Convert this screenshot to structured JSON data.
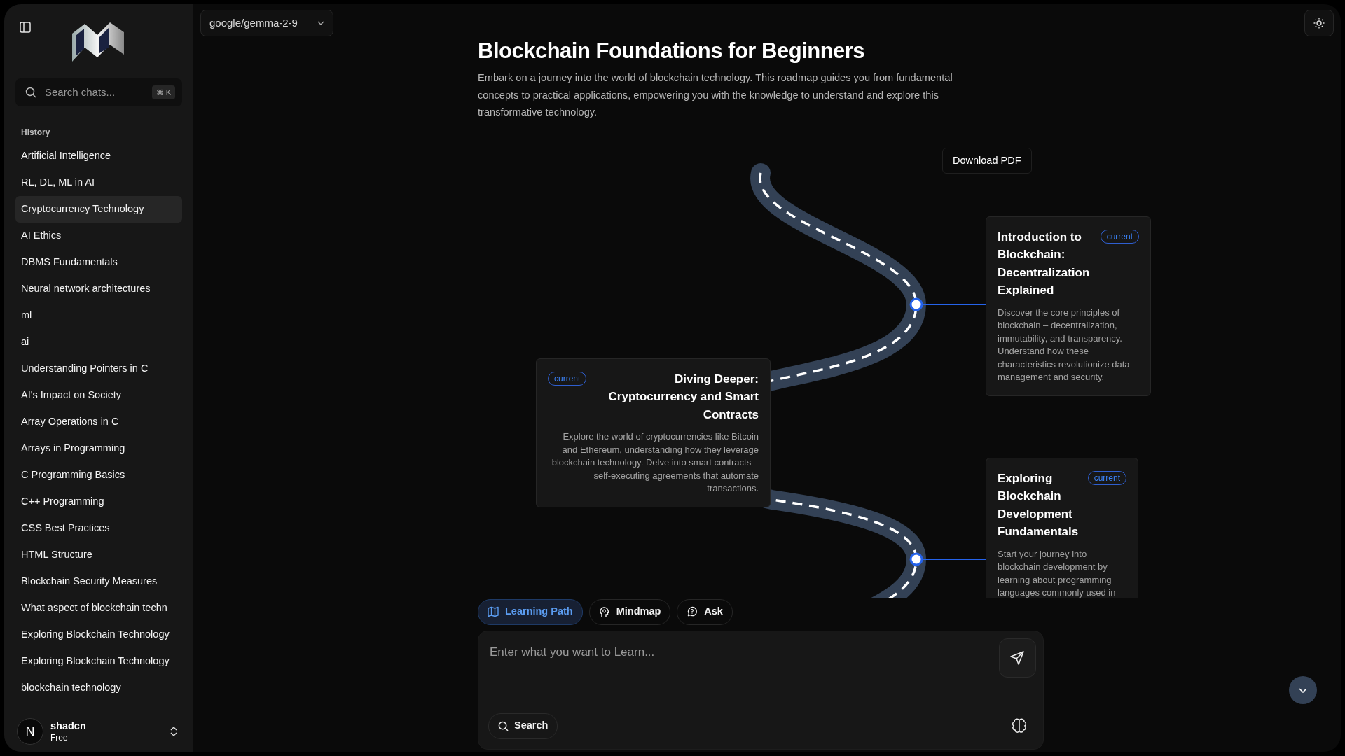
{
  "sidebar": {
    "search": {
      "placeholder": "Search chats...",
      "shortcut": "⌘ K"
    },
    "history_label": "History",
    "history": [
      {
        "title": "Artificial Intelligence",
        "selected": false
      },
      {
        "title": "RL, DL, ML in AI",
        "selected": false
      },
      {
        "title": "Cryptocurrency Technology",
        "selected": true
      },
      {
        "title": "AI Ethics",
        "selected": false
      },
      {
        "title": "DBMS Fundamentals",
        "selected": false
      },
      {
        "title": "Neural network architectures",
        "selected": false
      },
      {
        "title": "ml",
        "selected": false
      },
      {
        "title": "ai",
        "selected": false
      },
      {
        "title": "Understanding Pointers in C",
        "selected": false
      },
      {
        "title": "AI's Impact on Society",
        "selected": false
      },
      {
        "title": "Array Operations in C",
        "selected": false
      },
      {
        "title": "Arrays in Programming",
        "selected": false
      },
      {
        "title": "C Programming Basics",
        "selected": false
      },
      {
        "title": "C++ Programming",
        "selected": false
      },
      {
        "title": "CSS Best Practices",
        "selected": false
      },
      {
        "title": "HTML Structure",
        "selected": false
      },
      {
        "title": "Blockchain Security Measures",
        "selected": false
      },
      {
        "title": "What aspect of blockchain techn",
        "selected": false
      },
      {
        "title": "Exploring Blockchain Technology",
        "selected": false
      },
      {
        "title": "Exploring Blockchain Technology",
        "selected": false
      },
      {
        "title": "blockchain technology",
        "selected": false
      }
    ],
    "user": {
      "initial": "N",
      "name": "shadcn",
      "plan": "Free"
    }
  },
  "model": "google/gemma-2-9",
  "roadmap": {
    "title": "Blockchain Foundations for Beginners",
    "description": "Embark on a journey into the world of blockchain technology. This roadmap guides you from fundamental concepts to practical applications, empowering you with the knowledge to understand and explore this transformative technology.",
    "download_label": "Download PDF",
    "milestones": [
      {
        "title": "Introduction to Blockchain: Decentralization Explained",
        "badge": "current",
        "description": "Discover the core principles of blockchain – decentralization, immutability, and transparency. Understand how these characteristics revolutionize data management and security."
      },
      {
        "title": "Diving Deeper: Cryptocurrency and Smart Contracts",
        "badge": "current",
        "description": "Explore the world of cryptocurrencies like Bitcoin and Ethereum, understanding how they leverage blockchain technology. Delve into smart contracts – self-executing agreements that automate transactions."
      },
      {
        "title": "Exploring Blockchain Development Fundamentals",
        "badge": "current",
        "description": "Start your journey into blockchain development by learning about programming languages commonly used in"
      }
    ]
  },
  "modes": [
    {
      "label": "Learning Path",
      "selected": true
    },
    {
      "label": "Mindmap",
      "selected": false
    },
    {
      "label": "Ask",
      "selected": false
    }
  ],
  "prompt": {
    "placeholder": "Enter what you want to Learn...",
    "search_label": "Search"
  }
}
